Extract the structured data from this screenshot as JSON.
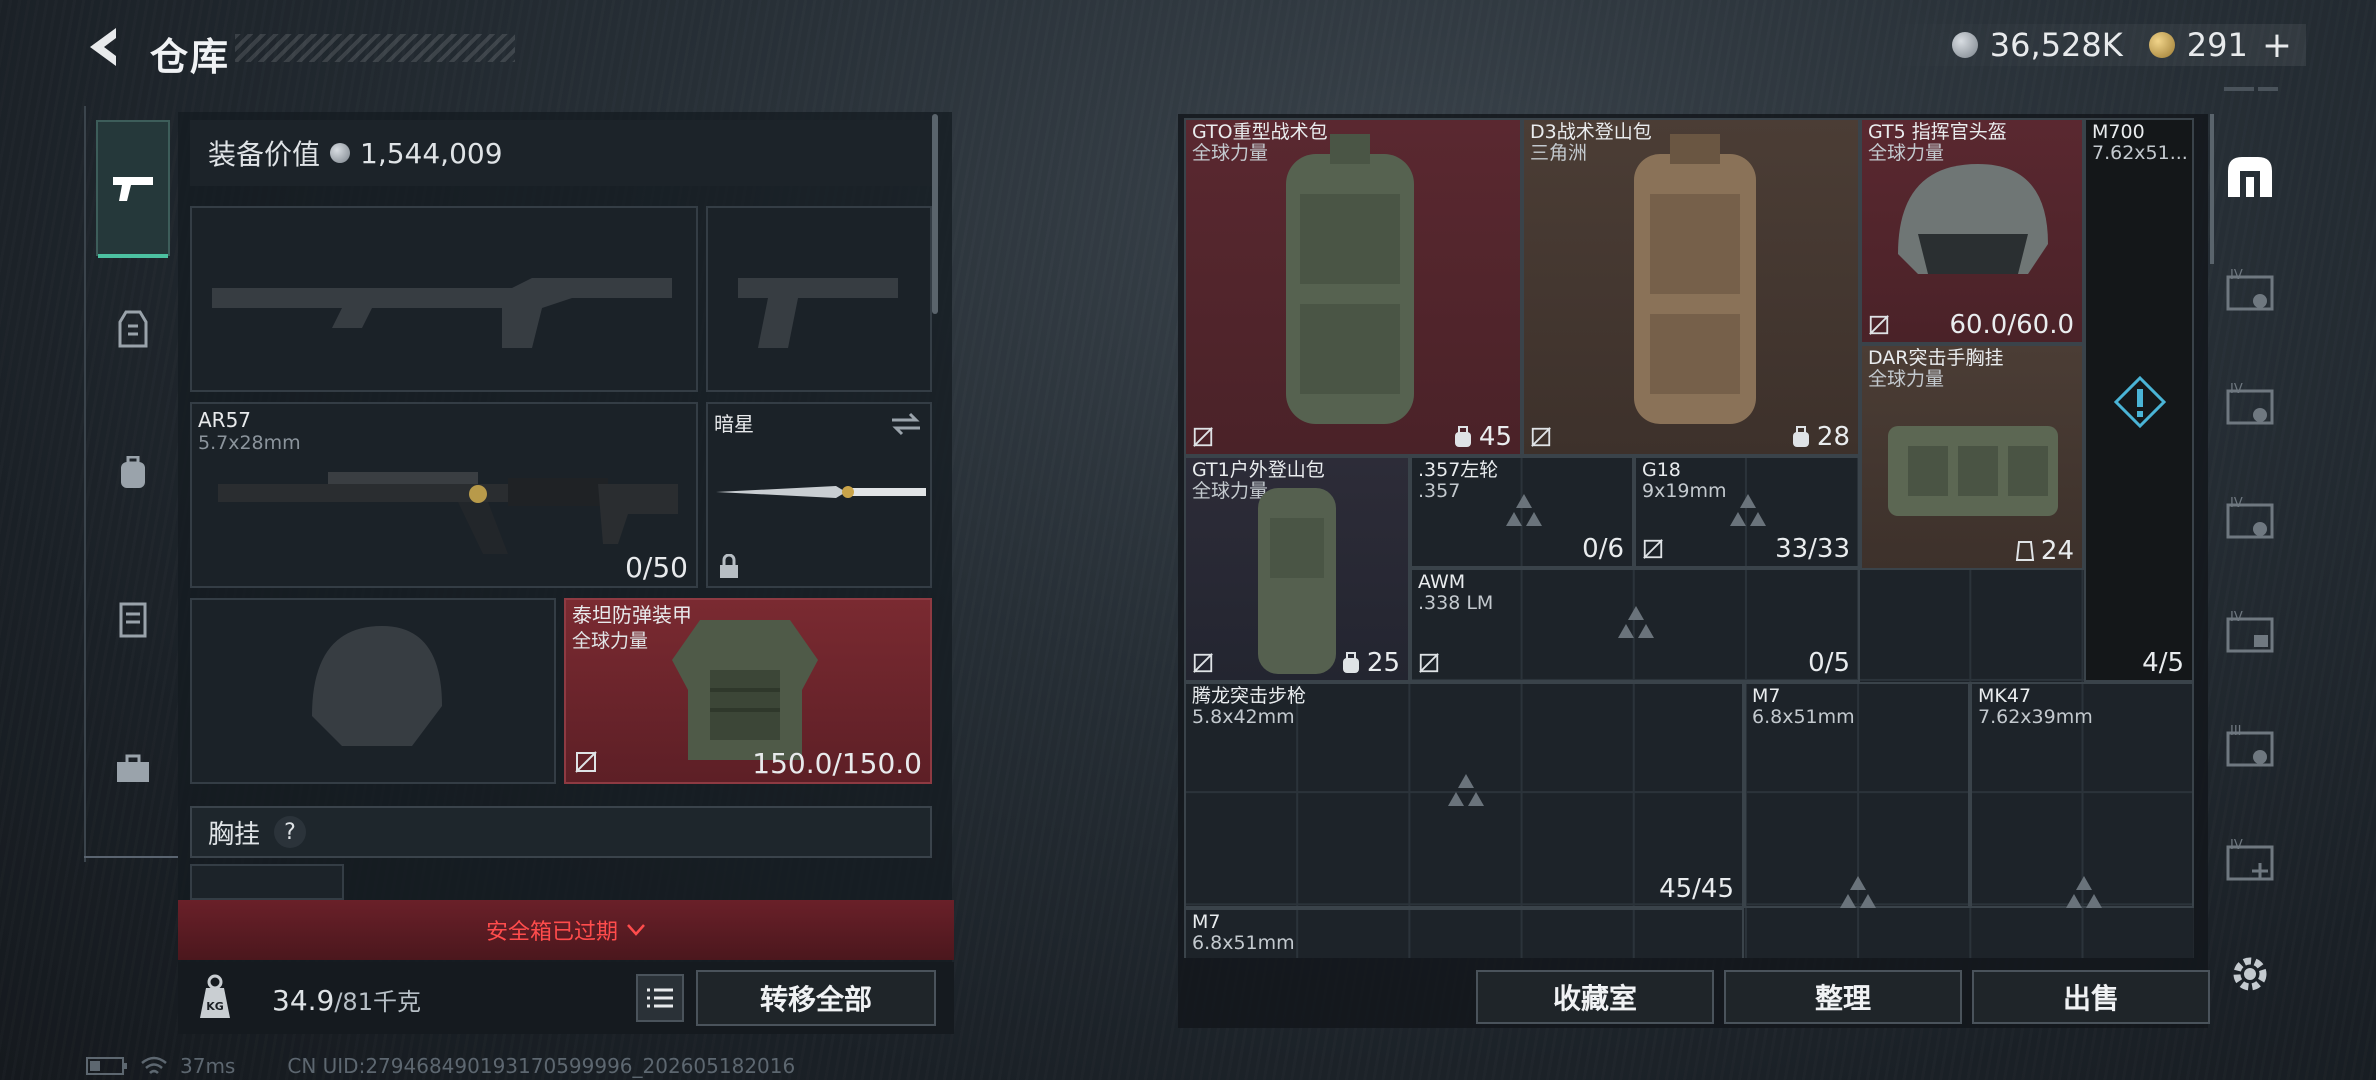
{
  "header": {
    "title": "仓库",
    "currency1": "36,528K",
    "currency2": "291",
    "plus": "+"
  },
  "equip": {
    "label": "装备价值",
    "value": "1,544,009"
  },
  "slots": {
    "ar": {
      "name": "AR57",
      "sub": "5.7x28mm",
      "ammo": "0/50"
    },
    "knife": {
      "name": "暗星"
    },
    "armor": {
      "name": "泰坦防弹装甲",
      "sub": "全球力量",
      "dur": "150.0/150.0"
    },
    "chest": {
      "label": "胸挂",
      "q": "?"
    }
  },
  "expired": "安全箱已过期",
  "footer": {
    "weight": "34.9",
    "max": "/81千克",
    "transfer": "转移全部"
  },
  "status": {
    "ping": "37ms",
    "uid": "CN UID:279468490193170599996_202605182016"
  },
  "stash": {
    "items": [
      {
        "name": "GTO重型战术包",
        "sub": "全球力量",
        "val": "45"
      },
      {
        "name": "D3战术登山包",
        "sub": "三角洲",
        "val": "28"
      },
      {
        "name": "GT5 指挥官头盔",
        "sub": "全球力量",
        "val": "60.0/60.0"
      },
      {
        "name": "M700",
        "sub": "7.62x51...",
        "val": "4/5"
      },
      {
        "name": "DAR突击手胸挂",
        "sub": "全球力量",
        "val": "24"
      },
      {
        "name": "GT1户外登山包",
        "sub": "全球力量",
        "val": "25"
      },
      {
        "name": ".357左轮",
        "sub": ".357",
        "val": "0/6"
      },
      {
        "name": "G18",
        "sub": "9x19mm",
        "val": "33/33"
      },
      {
        "name": "AWM",
        "sub": ".338 LM",
        "val": "0/5"
      },
      {
        "name": "腾龙突击步枪",
        "sub": "5.8x42mm",
        "val": "45/45"
      },
      {
        "name": "M7",
        "sub": "6.8x51mm",
        "val": ""
      },
      {
        "name": "MK47",
        "sub": "7.62x39mm",
        "val": ""
      },
      {
        "name": "M7",
        "sub": "6.8x51mm",
        "val": ""
      }
    ],
    "buttons": {
      "collect": "收藏室",
      "sort": "整理",
      "sell": "出售"
    }
  },
  "colors": {
    "accent": "#4cc1a1",
    "red": "#ff4c4c",
    "stashRed": "#5a2830"
  }
}
